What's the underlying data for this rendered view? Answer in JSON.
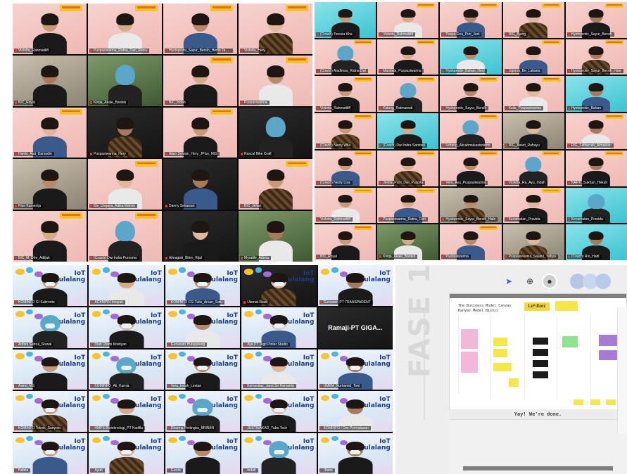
{
  "panels": {
    "top_left": {
      "tiles": [
        {
          "name": "Violetta_Rahmatiliff",
          "bg": "pink"
        },
        {
          "name": "Puspasiwarina_Ratna_Dari_Ratsu",
          "bg": "pink"
        },
        {
          "name": "Hystoprotiv_Sayur_Bersih_Herlin Tanjur",
          "bg": "pink"
        },
        {
          "name": "Violetta_Hery",
          "bg": "pink"
        },
        {
          "name": "BIC_Royal",
          "bg": "room"
        },
        {
          "name": "Kintja_Akale_Bantek",
          "bg": "green"
        },
        {
          "name": "BIC_Indah",
          "bg": "pink"
        },
        {
          "name": "Puspasiwarina",
          "bg": "pink"
        },
        {
          "name": "Hardo_Ajat_Darsudin",
          "bg": "pink"
        },
        {
          "name": "Puspasiwarina_Hery",
          "bg": "dark"
        },
        {
          "name": "Alain Sylvain_Hery_JPlus_MIS",
          "bg": "pink"
        },
        {
          "name": "Rascal Bike Craft",
          "bg": "dark"
        },
        {
          "name": "Rise Kameniju",
          "bg": "room"
        },
        {
          "name": "Ele_Ungaya_Adika Mahris",
          "bg": "pink"
        },
        {
          "name": "Danny Setiawan",
          "bg": "dark"
        },
        {
          "name": "BIC_Jefian",
          "bg": "pink"
        },
        {
          "name": "BIC_M_Dhe_Adiljuk",
          "bg": "pink"
        },
        {
          "name": "(Coach) Dwi Indra Purnomo",
          "bg": "pink"
        },
        {
          "name": "Almagisti_Bhim_Rijal",
          "bg": "dark"
        },
        {
          "name": "Myrattle_Adena",
          "bg": "green"
        }
      ]
    },
    "top_right": {
      "tiles": [
        {
          "name": "(Coach) Teresia Kha",
          "bg": "cyan"
        },
        {
          "name": "Violetta_Rahmatiliff",
          "bg": "pink"
        },
        {
          "name": "Puspa Ena_Puri_Juni",
          "bg": "pink"
        },
        {
          "name": "RIG_Ajeng",
          "bg": "pink"
        },
        {
          "name": "Hystoprotiv_Sayur_Bersih",
          "bg": "pink"
        },
        {
          "name": "(Coach) Aladimas_Ratna Dwi",
          "bg": "pink"
        },
        {
          "name": "Mandala_Puspasiwarina",
          "bg": "pink"
        },
        {
          "name": "Hystoprotiv_Bahan_Hery",
          "bg": "cyan"
        },
        {
          "name": "Ligersa_Be_Labana",
          "bg": "pink"
        },
        {
          "name": "Hystoprotiv_Sayur_Bersih_Hale",
          "bg": "pink"
        },
        {
          "name": "Violetta_Rahmatiliff",
          "bg": "pink"
        },
        {
          "name": "Kidung_Ratmawati",
          "bg": "pink"
        },
        {
          "name": "Hystoprotiv_Sayur_Bersih",
          "bg": "pink"
        },
        {
          "name": "Kaila_Puspasiwarina",
          "bg": "pink"
        },
        {
          "name": "Hystoprotiv_Bahan",
          "bg": "cyan"
        },
        {
          "name": "(Coach) Nesty Wila",
          "bg": "pink"
        },
        {
          "name": "(Coach) Dwi Indra Santoso",
          "bg": "cyan"
        },
        {
          "name": "Lintang_Alicahmukasiwianto",
          "bg": "pink"
        },
        {
          "name": "RIG_Astuti_Rahayu",
          "bg": "room"
        },
        {
          "name": "RIG_Fathurrah_Almaidan",
          "bg": "pink"
        },
        {
          "name": "(Coach) Nesty Lisa",
          "bg": "pink"
        },
        {
          "name": "Jenita_Putri_Dwi_Puspita",
          "bg": "pink"
        },
        {
          "name": "Vero_Ayu_Puspasiwarina",
          "bg": "pink"
        },
        {
          "name": "Violetta_Ra_Ayu_Indah",
          "bg": "pink"
        },
        {
          "name": "NAFTI_Sukhan_Hekuh",
          "bg": "pink"
        },
        {
          "name": "Violetta_Rahmatiliff",
          "bg": "pink"
        },
        {
          "name": "Puspasiwarina_Ratna_Dari",
          "bg": "pink"
        },
        {
          "name": "Hystoprotiv_Sayur_Bersih_Hale",
          "bg": "room"
        },
        {
          "name": "Kecamatan_Pravida",
          "bg": "pink"
        },
        {
          "name": "Kecamatan_Pravida",
          "bg": "cyan"
        },
        {
          "name": "BIC_Royal",
          "bg": "pink"
        },
        {
          "name": "Kintja_Akale_Bantek",
          "bg": "green"
        },
        {
          "name": "Puspasiwarina",
          "bg": "pink"
        },
        {
          "name": "Puspasiwarina_Sejatul_Yahya",
          "bg": "room"
        },
        {
          "name": "(Coach) Rio_Hadi",
          "bg": "cyan"
        }
      ]
    },
    "bottom_left": {
      "logo_title_line1": "IoT",
      "logo_title_line2": "Bulalang",
      "tiles": [
        {
          "name": "KOMINFO GI Subronto",
          "bg": "iot"
        },
        {
          "name": "ACKMPRI Imayati",
          "bg": "iot"
        },
        {
          "name": "KOMINFO CG-Tulis_Arsan_Satu",
          "bg": "iot"
        },
        {
          "name": "Ulamat Riadi",
          "bg": "dark"
        },
        {
          "name": "Gunawan PT TRANSPARENT",
          "bg": "iot"
        },
        {
          "name": "Arifani Sahrul_Siswal",
          "bg": "iot"
        },
        {
          "name": "Diah Utami Kristiyan",
          "bg": "iot"
        },
        {
          "name": "Gunawan Hutagalung",
          "bg": "iot"
        },
        {
          "name": "Aya PT Digit Pintar Studio",
          "bg": "iot"
        },
        {
          "name": "Ramaji-PT  GIGA...",
          "bg": "dark",
          "big": true
        },
        {
          "name": "Astrid_MS",
          "bg": "iot"
        },
        {
          "name": "KOMINFO_Ati_Kurnia",
          "bg": "iot"
        },
        {
          "name": "Vera_Indah_Lestari",
          "bg": "iot"
        },
        {
          "name": "Komunitas_Jarot Sri Haryanto",
          "bg": "iot"
        },
        {
          "name": "UMKM_Nurhamid_Toni",
          "bg": "iot"
        },
        {
          "name": "KOMINFO Teknik_Sanyoto",
          "bg": "iot"
        },
        {
          "name": "HMPS Bioteknologi_PT Kadilla",
          "bg": "iot"
        },
        {
          "name": "Dharma Pettingka_BRIN/IN",
          "bg": "iot"
        },
        {
          "name": "JUSTINAKAD_Tuba Tech",
          "bg": "iot"
        },
        {
          "name": "KOMINFO / Dwi Permatasari",
          "bg": "iot"
        },
        {
          "name": "Nabila",
          "bg": "iot"
        },
        {
          "name": "Ayah",
          "bg": "iot"
        },
        {
          "name": "Guruh",
          "bg": "iot"
        },
        {
          "name": "Indah",
          "bg": "iot"
        },
        {
          "name": "Utami",
          "bg": "iot"
        }
      ]
    },
    "bottom_right": {
      "fase_label": "FASE 1",
      "board_title_line1": "The Business Model Canvas",
      "board_title_line2": "Kanvas Model Bisnis",
      "board_logo": "Lu*-Eorz",
      "done_text": "Yay! We're done.",
      "toolbar_icons": [
        "cursor-icon",
        "zoom-icon",
        "avatar-icon",
        "user-avatar-1",
        "user-avatar-2",
        "user-avatar-3"
      ]
    }
  },
  "colors": {
    "zoom_name_red": "#e53935",
    "sticky_yellow": "#f6e64a",
    "sticky_pink": "#f3b7d9",
    "sticky_black": "#1b1b1b",
    "sticky_purple": "#a77ad6",
    "sticky_green": "#8fe38f"
  }
}
